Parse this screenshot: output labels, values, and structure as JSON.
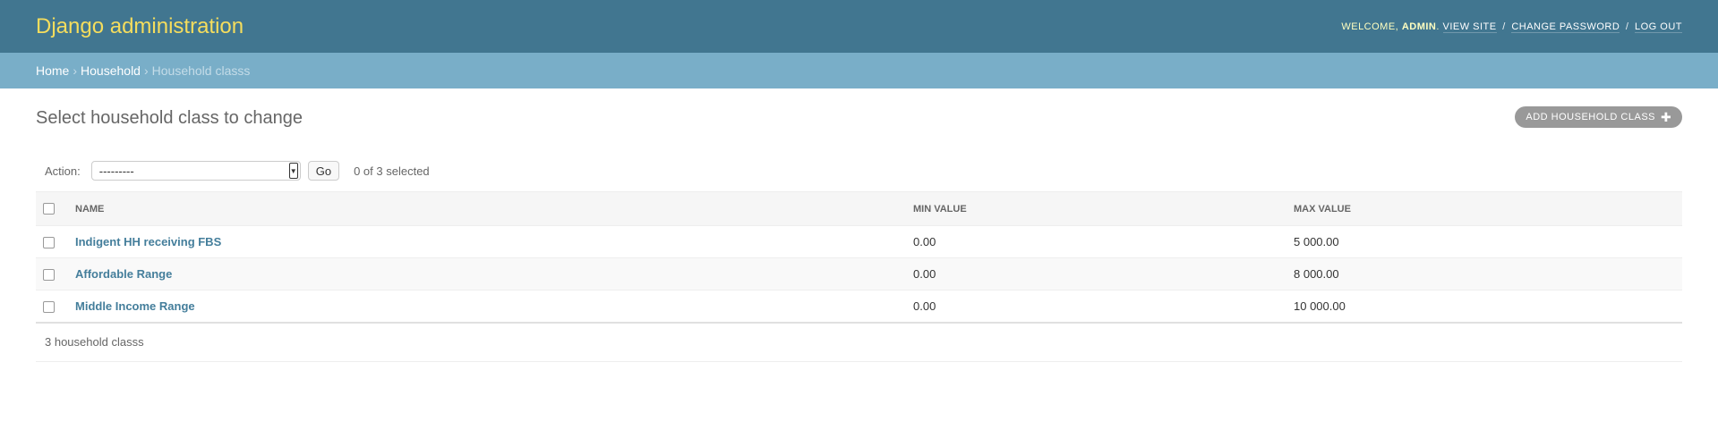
{
  "header": {
    "branding": "Django administration",
    "welcome": "Welcome,",
    "username": "admin",
    "view_site": "View site",
    "change_password": "Change password",
    "log_out": "Log out",
    "sep": "/"
  },
  "breadcrumbs": {
    "home": "Home",
    "app": "Household",
    "current": "Household classs",
    "sep": "›"
  },
  "content": {
    "title": "Select household class to change",
    "add_button": "Add household class",
    "add_icon": "plus-icon"
  },
  "actions": {
    "label": "Action:",
    "selected_value": "---------",
    "go_label": "Go",
    "counter": "0 of 3 selected"
  },
  "table": {
    "headers": [
      "Name",
      "Min value",
      "Max value"
    ],
    "rows": [
      {
        "name": "Indigent HH receiving FBS",
        "min_value": "0.00",
        "max_value": "5 000.00"
      },
      {
        "name": "Affordable Range",
        "min_value": "0.00",
        "max_value": "8 000.00"
      },
      {
        "name": "Middle Income Range",
        "min_value": "0.00",
        "max_value": "10 000.00"
      }
    ]
  },
  "paginator": "3 household classs",
  "colors": {
    "header_bg": "#417690",
    "branding": "#f5dd5d",
    "breadcrumbs_bg": "#79aec8",
    "link": "#447e9b",
    "add_button_bg": "#999999"
  }
}
